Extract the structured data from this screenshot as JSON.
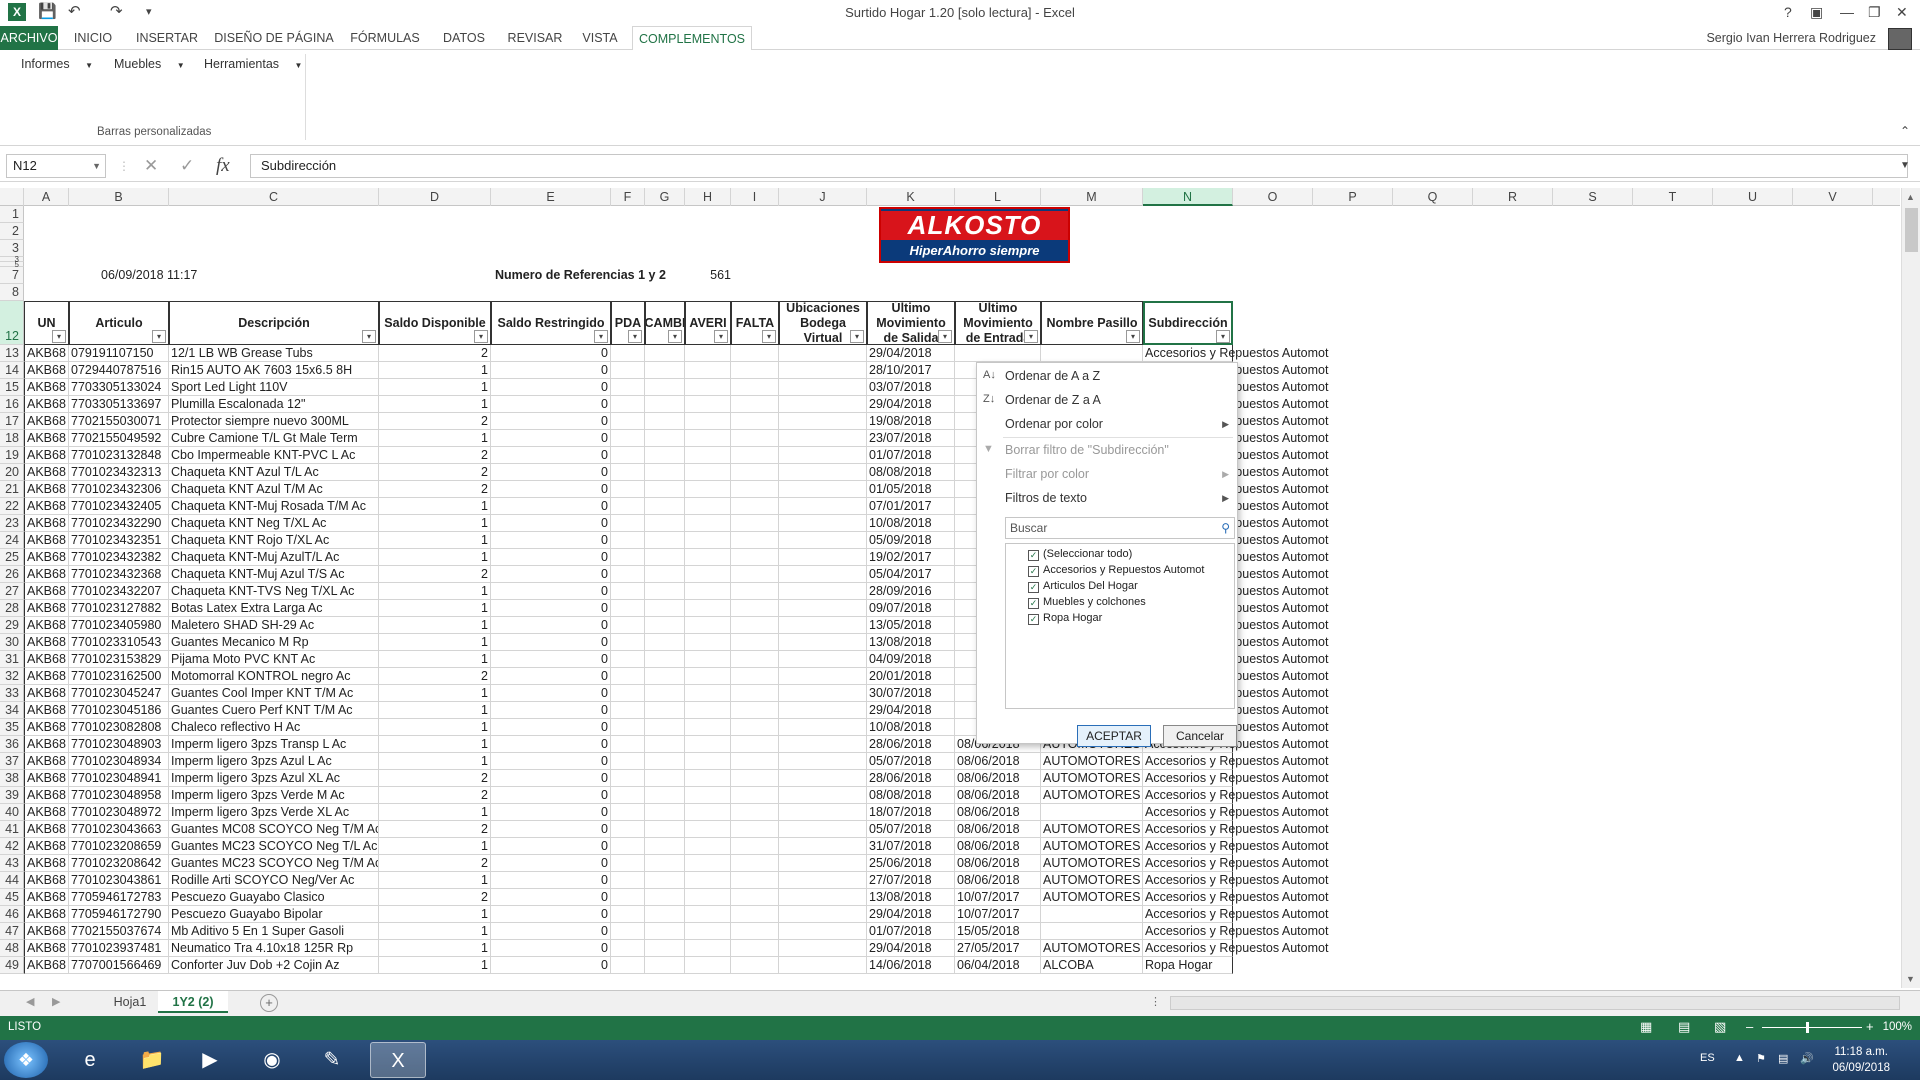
{
  "window": {
    "title": "Surtido Hogar 1.20  [solo lectura] - Excel",
    "app_icon": "X"
  },
  "tabs": {
    "file": "ARCHIVO",
    "items": [
      "INICIO",
      "INSERTAR",
      "DISEÑO DE PÁGINA",
      "FÓRMULAS",
      "DATOS",
      "REVISAR",
      "VISTA",
      "COMPLEMENTOS"
    ],
    "user": "Sergio Ivan Herrera Rodriguez"
  },
  "ribbon": {
    "buttons": [
      "Informes",
      "Muebles",
      "Herramientas"
    ],
    "group": "Barras personalizadas"
  },
  "formula": {
    "name_box": "N12",
    "fx": "fx",
    "content": "Subdirección"
  },
  "columns": [
    "A",
    "B",
    "C",
    "D",
    "E",
    "F",
    "G",
    "H",
    "I",
    "J",
    "K",
    "L",
    "M",
    "N",
    "O",
    "P",
    "Q",
    "R",
    "S",
    "T",
    "U",
    "V"
  ],
  "logo": {
    "line1": "ALKOSTO",
    "line2": "HiperAhorro siempre"
  },
  "info": {
    "date": "06/09/2018 11:17",
    "ref_label": "Numero de Referencias 1 y 2",
    "ref_count": "561"
  },
  "headers": [
    "UN",
    "Articulo",
    "Descripción",
    "Saldo Disponible",
    "Saldo Restringido",
    "PDA",
    "CAMBI",
    "AVERI",
    "FALTA",
    "Ubicaciones Bodega Virtual",
    "Último Movimiento de Salida",
    "Último Movimiento de Entrada",
    "Nombre Pasillo",
    "Subdirección"
  ],
  "rows": [
    [
      "13",
      "AKB68",
      "079191107150",
      "12/1 LB WB Grease Tubs",
      "2",
      "0",
      "29/04/2018",
      "",
      "",
      "Accesorios y Repuestos Automot"
    ],
    [
      "14",
      "AKB68",
      "0729440787516",
      "Rin15 AUTO AK 7603 15x6.5 8H",
      "1",
      "0",
      "28/10/2017",
      "",
      "",
      "Accesorios y Repuestos Automot"
    ],
    [
      "15",
      "AKB68",
      "7703305133024",
      "Sport Led Light 110V",
      "1",
      "0",
      "03/07/2018",
      "",
      "",
      "Accesorios y Repuestos Automot"
    ],
    [
      "16",
      "AKB68",
      "7703305133697",
      "Plumilla Escalonada 12\"",
      "1",
      "0",
      "29/04/2018",
      "",
      "",
      "Accesorios y Repuestos Automot"
    ],
    [
      "17",
      "AKB68",
      "7702155030071",
      "Protector siempre nuevo 300ML",
      "2",
      "0",
      "19/08/2018",
      "",
      "",
      "Accesorios y Repuestos Automot"
    ],
    [
      "18",
      "AKB68",
      "7702155049592",
      "Cubre Camione T/L Gt Male Term",
      "1",
      "0",
      "23/07/2018",
      "",
      "",
      "Accesorios y Repuestos Automot"
    ],
    [
      "19",
      "AKB68",
      "7701023132848",
      "Cbo Impermeable KNT-PVC L Ac",
      "2",
      "0",
      "01/07/2018",
      "",
      "",
      "Accesorios y Repuestos Automot"
    ],
    [
      "20",
      "AKB68",
      "7701023432313",
      "Chaqueta KNT Azul T/L Ac",
      "2",
      "0",
      "08/08/2018",
      "",
      "",
      "Accesorios y Repuestos Automot"
    ],
    [
      "21",
      "AKB68",
      "7701023432306",
      "Chaqueta KNT Azul T/M Ac",
      "2",
      "0",
      "01/05/2018",
      "",
      "",
      "Accesorios y Repuestos Automot"
    ],
    [
      "22",
      "AKB68",
      "7701023432405",
      "Chaqueta KNT-Muj Rosada T/M Ac",
      "1",
      "0",
      "07/01/2017",
      "",
      "",
      "Accesorios y Repuestos Automot"
    ],
    [
      "23",
      "AKB68",
      "7701023432290",
      "Chaqueta KNT Neg T/XL Ac",
      "1",
      "0",
      "10/08/2018",
      "",
      "",
      "Accesorios y Repuestos Automot"
    ],
    [
      "24",
      "AKB68",
      "7701023432351",
      "Chaqueta KNT Rojo T/XL Ac",
      "1",
      "0",
      "05/09/2018",
      "",
      "",
      "Accesorios y Repuestos Automot"
    ],
    [
      "25",
      "AKB68",
      "7701023432382",
      "Chaqueta KNT-Muj AzulT/L Ac",
      "1",
      "0",
      "19/02/2017",
      "",
      "",
      "Accesorios y Repuestos Automot"
    ],
    [
      "26",
      "AKB68",
      "7701023432368",
      "Chaqueta KNT-Muj Azul T/S Ac",
      "2",
      "0",
      "05/04/2017",
      "",
      "",
      "Accesorios y Repuestos Automot"
    ],
    [
      "27",
      "AKB68",
      "7701023432207",
      "Chaqueta KNT-TVS Neg T/XL Ac",
      "1",
      "0",
      "28/09/2016",
      "",
      "",
      "Accesorios y Repuestos Automot"
    ],
    [
      "28",
      "AKB68",
      "7701023127882",
      "Botas Latex Extra Larga Ac",
      "1",
      "0",
      "09/07/2018",
      "",
      "",
      "Accesorios y Repuestos Automot"
    ],
    [
      "29",
      "AKB68",
      "7701023405980",
      "Maletero SHAD SH-29 Ac",
      "1",
      "0",
      "13/05/2018",
      "",
      "",
      "Accesorios y Repuestos Automot"
    ],
    [
      "30",
      "AKB68",
      "7701023310543",
      "Guantes Mecanico M Rp",
      "1",
      "0",
      "13/08/2018",
      "",
      "",
      "Accesorios y Repuestos Automot"
    ],
    [
      "31",
      "AKB68",
      "7701023153829",
      "Pijama Moto PVC KNT Ac",
      "1",
      "0",
      "04/09/2018",
      "",
      "",
      "Accesorios y Repuestos Automot"
    ],
    [
      "32",
      "AKB68",
      "7701023162500",
      "Motomorral KONTROL negro Ac",
      "2",
      "0",
      "20/01/2018",
      "",
      "",
      "Accesorios y Repuestos Automot"
    ],
    [
      "33",
      "AKB68",
      "7701023045247",
      "Guantes Cool Imper KNT T/M Ac",
      "1",
      "0",
      "30/07/2018",
      "",
      "",
      "Accesorios y Repuestos Automot"
    ],
    [
      "34",
      "AKB68",
      "7701023045186",
      "Guantes Cuero Perf KNT T/M Ac",
      "1",
      "0",
      "29/04/2018",
      "",
      "",
      "Accesorios y Repuestos Automot"
    ],
    [
      "35",
      "AKB68",
      "7701023082808",
      "Chaleco reflectivo H Ac",
      "1",
      "0",
      "10/08/2018",
      "",
      "",
      "Accesorios y Repuestos Automot"
    ],
    [
      "36",
      "AKB68",
      "7701023048903",
      "Imperm ligero 3pzs Transp L Ac",
      "1",
      "0",
      "28/06/2018",
      "08/06/2018",
      "AUTOMOTORES",
      "Accesorios y Repuestos Automot"
    ],
    [
      "37",
      "AKB68",
      "7701023048934",
      "Imperm ligero 3pzs Azul L Ac",
      "1",
      "0",
      "05/07/2018",
      "08/06/2018",
      "AUTOMOTORES",
      "Accesorios y Repuestos Automot"
    ],
    [
      "38",
      "AKB68",
      "7701023048941",
      "Imperm ligero 3pzs Azul XL Ac",
      "2",
      "0",
      "28/06/2018",
      "08/06/2018",
      "AUTOMOTORES",
      "Accesorios y Repuestos Automot"
    ],
    [
      "39",
      "AKB68",
      "7701023048958",
      "Imperm ligero 3pzs Verde M Ac",
      "2",
      "0",
      "08/08/2018",
      "08/06/2018",
      "AUTOMOTORES",
      "Accesorios y Repuestos Automot"
    ],
    [
      "40",
      "AKB68",
      "7701023048972",
      "Imperm ligero 3pzs Verde XL Ac",
      "1",
      "0",
      "18/07/2018",
      "08/06/2018",
      "",
      "Accesorios y Repuestos Automot"
    ],
    [
      "41",
      "AKB68",
      "7701023043663",
      "Guantes MC08 SCOYCO Neg T/M Ac",
      "2",
      "0",
      "05/07/2018",
      "08/06/2018",
      "AUTOMOTORES",
      "Accesorios y Repuestos Automot"
    ],
    [
      "42",
      "AKB68",
      "7701023208659",
      "Guantes MC23 SCOYCO Neg T/L Ac",
      "1",
      "0",
      "31/07/2018",
      "08/06/2018",
      "AUTOMOTORES",
      "Accesorios y Repuestos Automot"
    ],
    [
      "43",
      "AKB68",
      "7701023208642",
      "Guantes MC23 SCOYCO Neg T/M Ac",
      "2",
      "0",
      "25/06/2018",
      "08/06/2018",
      "AUTOMOTORES",
      "Accesorios y Repuestos Automot"
    ],
    [
      "44",
      "AKB68",
      "7701023043861",
      "Rodille Arti SCOYCO Neg/Ver Ac",
      "1",
      "0",
      "27/07/2018",
      "08/06/2018",
      "AUTOMOTORES",
      "Accesorios y Repuestos Automot"
    ],
    [
      "45",
      "AKB68",
      "7705946172783",
      "Pescuezo Guayabo Clasico",
      "2",
      "0",
      "13/08/2018",
      "10/07/2017",
      "AUTOMOTORES",
      "Accesorios y Repuestos Automot"
    ],
    [
      "46",
      "AKB68",
      "7705946172790",
      "Pescuezo Guayabo Bipolar",
      "1",
      "0",
      "29/04/2018",
      "10/07/2017",
      "",
      "Accesorios y Repuestos Automot"
    ],
    [
      "47",
      "AKB68",
      "7702155037674",
      "Mb Aditivo 5 En 1 Super Gasoli",
      "1",
      "0",
      "01/07/2018",
      "15/05/2018",
      "",
      "Accesorios y Repuestos Automot"
    ],
    [
      "48",
      "AKB68",
      "7701023937481",
      "Neumatico Tra 4.10x18 125R Rp",
      "1",
      "0",
      "29/04/2018",
      "27/05/2017",
      "AUTOMOTORES",
      "Accesorios y Repuestos Automot"
    ],
    [
      "49",
      "AKB68",
      "7707001566469",
      "Conforter Juv Dob +2 Cojin Az",
      "1",
      "0",
      "14/06/2018",
      "06/04/2018",
      "ALCOBA",
      "Ropa Hogar"
    ]
  ],
  "dropdown": {
    "sort_az": "Ordenar de A a Z",
    "sort_za": "Ordenar de Z a A",
    "sort_color": "Ordenar por color",
    "clear_filter": "Borrar filtro de \"Subdirección\"",
    "filter_color": "Filtrar por color",
    "text_filters": "Filtros de texto",
    "search_placeholder": "Buscar",
    "items": [
      "(Seleccionar todo)",
      "Accesorios y Repuestos Automot",
      "Articulos Del Hogar",
      "Muebles y colchones",
      "Ropa Hogar"
    ],
    "ok": "ACEPTAR",
    "cancel": "Cancelar"
  },
  "sheets": [
    "Hoja1",
    "1Y2 (2)"
  ],
  "status": {
    "ready": "LISTO",
    "zoom": "100%"
  },
  "clock": {
    "time": "11:18 a.m.",
    "date": "06/09/2018",
    "lang": "ES"
  }
}
